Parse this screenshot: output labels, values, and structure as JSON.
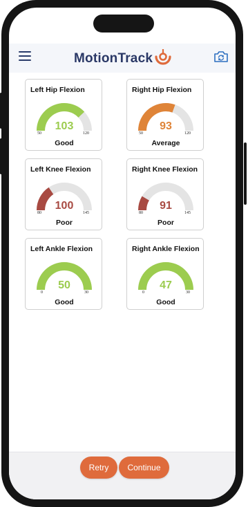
{
  "app": {
    "title": "MotionTrack"
  },
  "colors": {
    "brand": "#2a3866",
    "accent": "#df6b3c",
    "good": "#9ccc4f",
    "average": "#df8438",
    "poor": "#a84a42",
    "track": "#e4e4e4"
  },
  "icons": {
    "menu": "hamburger-icon",
    "camera": "camera-switch-icon",
    "logo": "logo-target-icon"
  },
  "gauges": [
    {
      "title": "Left Hip Flexion",
      "value": "103",
      "min": "50",
      "max": "120",
      "status": "Good",
      "fraction": 0.76,
      "level": "good"
    },
    {
      "title": "Right Hip Flexion",
      "value": "93",
      "min": "50",
      "max": "120",
      "status": "Average",
      "fraction": 0.61,
      "level": "average"
    },
    {
      "title": "Left Knee Flexion",
      "value": "100",
      "min": "80",
      "max": "145",
      "status": "Poor",
      "fraction": 0.31,
      "level": "poor"
    },
    {
      "title": "Right Knee Flexion",
      "value": "91",
      "min": "80",
      "max": "145",
      "status": "Poor",
      "fraction": 0.17,
      "level": "poor"
    },
    {
      "title": "Left Ankle Flexion",
      "value": "50",
      "min": "0",
      "max": "30",
      "status": "Good",
      "fraction": 1.0,
      "level": "good"
    },
    {
      "title": "Right Ankle Flexion",
      "value": "47",
      "min": "0",
      "max": "30",
      "status": "Good",
      "fraction": 1.0,
      "level": "good"
    }
  ],
  "actions": {
    "retry_label": "Retry",
    "continue_label": "Continue"
  }
}
